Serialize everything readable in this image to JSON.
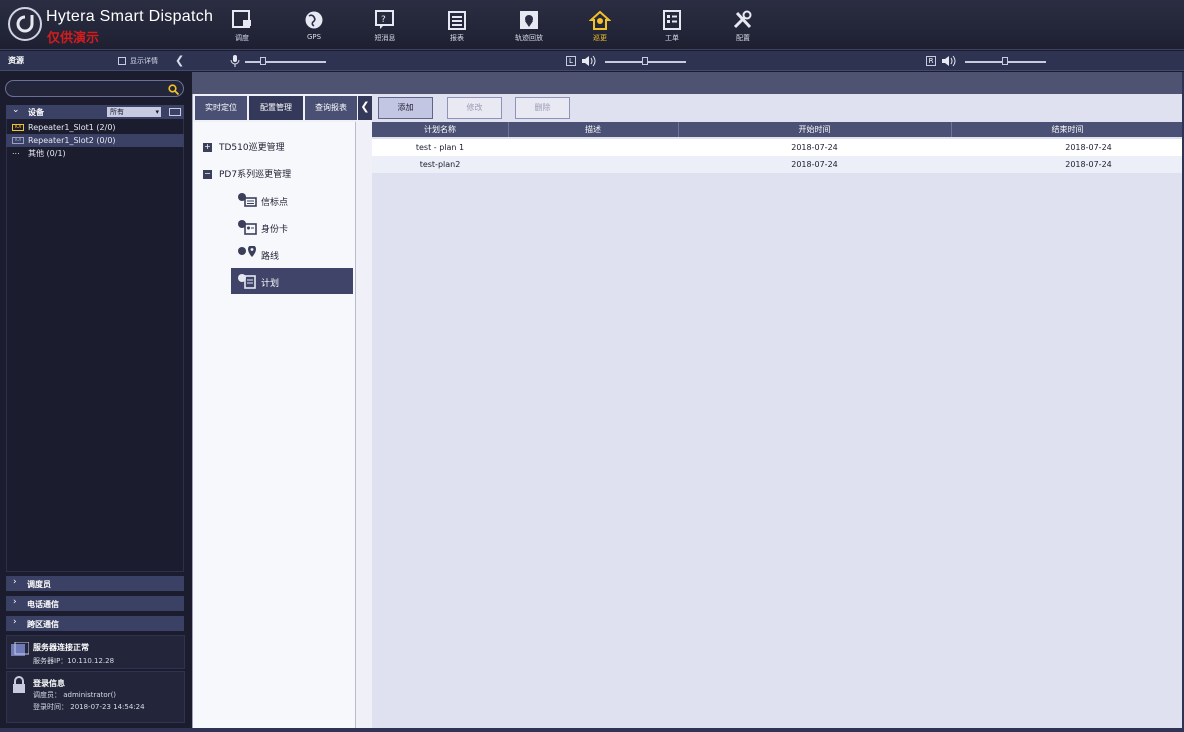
{
  "app": {
    "title": "Hytera Smart Dispatch",
    "subtitle": "仅供演示"
  },
  "nav": [
    {
      "label": "调度",
      "icon": "dispatch-icon"
    },
    {
      "label": "GPS",
      "icon": "globe-icon"
    },
    {
      "label": "短消息",
      "icon": "message-icon"
    },
    {
      "label": "报表",
      "icon": "report-icon"
    },
    {
      "label": "轨迹回放",
      "icon": "track-playback-icon"
    },
    {
      "label": "巡更",
      "icon": "patrol-icon",
      "active": true
    },
    {
      "label": "工单",
      "icon": "work-order-icon"
    },
    {
      "label": "配置",
      "icon": "config-tools-icon"
    }
  ],
  "toolbar": {
    "resources_title": "资源",
    "show_detail_label": "显示详情",
    "channel_left": "L",
    "channel_right": "R"
  },
  "left": {
    "search_placeholder": "",
    "devices_label": "设备",
    "device_filter": "所有",
    "devices": [
      {
        "name": "Repeater1_Slot1 (2/0)",
        "icon_text": "IOI",
        "selected": false
      },
      {
        "name": "Repeater1_Slot2 (0/0)",
        "icon_text": "IOI",
        "selected": true
      },
      {
        "name": "其他 (0/1)",
        "icon_text": "...",
        "selected": false
      }
    ],
    "accordions": [
      "调度员",
      "电话通信",
      "跨区通信"
    ],
    "server": {
      "title": "服务器连接正常",
      "ip_label": "服务器IP：",
      "ip": "10.110.12.28"
    },
    "login": {
      "title": "登录信息",
      "dispatcher_label": "调度员：",
      "dispatcher": "administrator()",
      "time_label": "登录时间：",
      "time": "2018-07-23 14:54:24"
    }
  },
  "mid": {
    "tabs": [
      "实时定位",
      "配置管理",
      "查询报表"
    ],
    "tree": {
      "group1": "TD510巡更管理",
      "group2": "PD7系列巡更管理",
      "leaves": [
        "信标点",
        "身份卡",
        "路线",
        "计划"
      ]
    }
  },
  "content": {
    "buttons": {
      "add": "添加",
      "edit": "修改",
      "delete": "删除"
    },
    "columns": [
      "计划名称",
      "描述",
      "开始时间",
      "结束时间"
    ],
    "rows": [
      {
        "name": "test - plan 1",
        "desc": "",
        "start": "2018-07-24",
        "end": "2018-07-24"
      },
      {
        "name": "test-plan2",
        "desc": "",
        "start": "2018-07-24",
        "end": "2018-07-24"
      }
    ]
  },
  "colors": {
    "accent_yellow": "#f3c228",
    "brand_red": "#d41c1c",
    "header_navy": "#4b5075",
    "selected_leaf": "#3f4468"
  }
}
